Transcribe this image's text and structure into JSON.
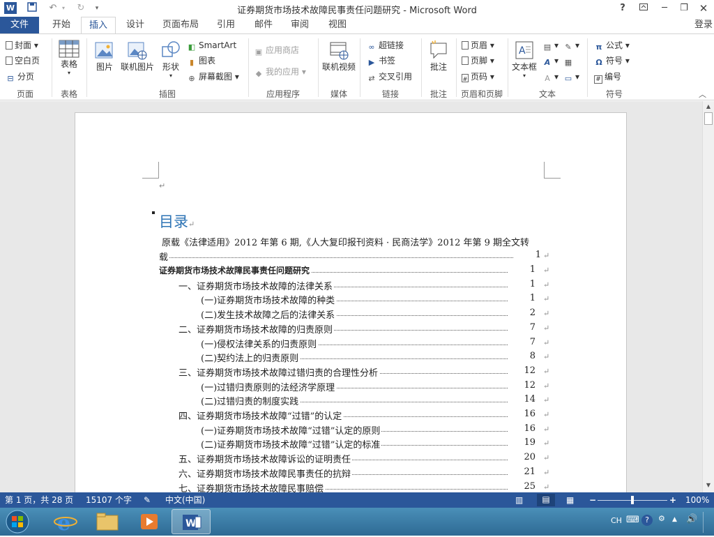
{
  "window": {
    "title": "证券期货市场技术故障民事责任问题研究 - Microsoft Word",
    "help": "?",
    "login": "登录"
  },
  "tabs": [
    "文件",
    "开始",
    "插入",
    "设计",
    "页面布局",
    "引用",
    "邮件",
    "审阅",
    "视图"
  ],
  "ribbon": {
    "pages": {
      "cover": "封面",
      "blank": "空白页",
      "break": "分页",
      "label": "页面"
    },
    "table": {
      "button": "表格",
      "label": "表格"
    },
    "illustrations": {
      "picture": "图片",
      "online_picture": "联机图片",
      "shapes": "形状",
      "smartart": "SmartArt",
      "chart": "图表",
      "screenshot": "屏幕截图",
      "label": "插图"
    },
    "apps": {
      "store": "应用商店",
      "my_apps": "我的应用",
      "label": "应用程序"
    },
    "media": {
      "online_video": "联机视频",
      "label": "媒体"
    },
    "links": {
      "hyperlink": "超链接",
      "bookmark": "书签",
      "cross_ref": "交叉引用",
      "label": "链接"
    },
    "comments": {
      "comment": "批注",
      "label": "批注"
    },
    "header_footer": {
      "header": "页眉",
      "footer": "页脚",
      "page_number": "页码",
      "label": "页眉和页脚"
    },
    "text": {
      "textbox": "文本框",
      "label": "文本"
    },
    "symbols": {
      "equation": "公式",
      "symbol": "符号",
      "number": "编号",
      "label": "符号"
    }
  },
  "document": {
    "toc_heading": "目录",
    "intro_line1": "原载《法律适用》2012 年第 6 期,《人大复印报刊资料 · 民商法学》2012 年第 9 期全文转",
    "intro_line2": "载",
    "intro_page": "1",
    "entries": [
      {
        "text": "证券期货市场技术故障民事责任问题研究",
        "page": "1",
        "level": 0
      },
      {
        "text": "一、证券期货市场技术故障的法律关系",
        "page": "1",
        "level": 1
      },
      {
        "text": "(一)证券期货市场技术故障的种类",
        "page": "1",
        "level": 2
      },
      {
        "text": "(二)发生技术故障之后的法律关系",
        "page": "2",
        "level": 2
      },
      {
        "text": "二、证券期货市场技术故障的归责原则",
        "page": "7",
        "level": 1
      },
      {
        "text": "(一)侵权法律关系的归责原则",
        "page": "7",
        "level": 2
      },
      {
        "text": "(二)契约法上的归责原则",
        "page": "8",
        "level": 2
      },
      {
        "text": "三、证券期货市场技术故障过错归责的合理性分析",
        "page": "12",
        "level": 1
      },
      {
        "text": "(一)过错归责原则的法经济学原理",
        "page": "12",
        "level": 2
      },
      {
        "text": "(二)过错归责的制度实践",
        "page": "14",
        "level": 2
      },
      {
        "text": "四、证券期货市场技术故障“过错”的认定",
        "page": "16",
        "level": 1
      },
      {
        "text": "(一)证券期货市场技术故障“过错”认定的原则",
        "page": "16",
        "level": 2
      },
      {
        "text": "(二)证券期货市场技术故障“过错”认定的标准",
        "page": "19",
        "level": 2
      },
      {
        "text": "五、证券期货市场技术故障诉讼的证明责任",
        "page": "20",
        "level": 1
      },
      {
        "text": "六、证券期货市场技术故障民事责任的抗辩",
        "page": "21",
        "level": 1
      },
      {
        "text": "七、证券期货市场技术故障民事赔偿",
        "page": "25",
        "level": 1
      }
    ]
  },
  "status": {
    "page": "第 1 页，共 28 页",
    "words": "15107 个字",
    "language": "中文(中国)",
    "zoom": "100%",
    "zoom_level": 0.5
  },
  "taskbar": {
    "ime": "CH"
  },
  "colors": {
    "accent": "#2b579a",
    "heading": "#2e74b5"
  }
}
